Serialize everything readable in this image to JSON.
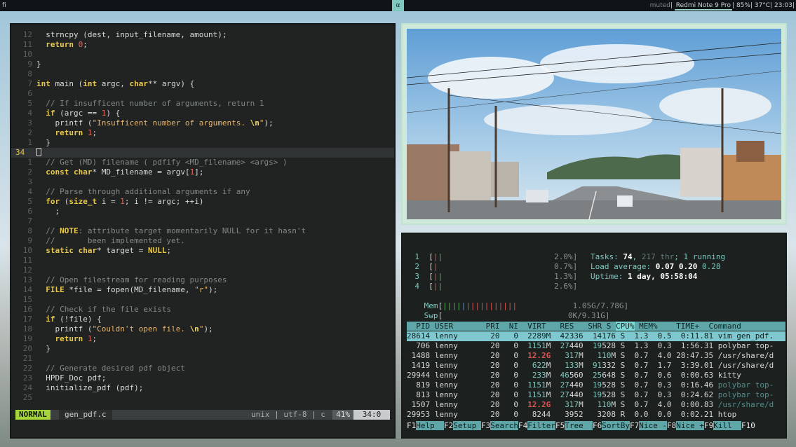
{
  "topbar": {
    "workspace": "fi",
    "layout": "α",
    "muted": "muted",
    "device": "Redmi Note 9 Pro",
    "battery": "85%",
    "temp": "37°C",
    "time": "23:03"
  },
  "editor": {
    "lines": [
      {
        "n": "12",
        "t": "  strncpy (dest, input_filename, amount);"
      },
      {
        "n": "11",
        "t": "  return 0;"
      },
      {
        "n": "10",
        "t": ""
      },
      {
        "n": "9",
        "t": "}"
      },
      {
        "n": "8",
        "t": ""
      },
      {
        "n": "7",
        "t": "int main (int argc, char** argv) {"
      },
      {
        "n": "6",
        "t": ""
      },
      {
        "n": "5",
        "t": "  // If insufficent number of arguments, return 1"
      },
      {
        "n": "4",
        "t": "  if (argc == 1) {"
      },
      {
        "n": "3",
        "t": "    printf (\"Insufficent number of arguments. \\n\");"
      },
      {
        "n": "2",
        "t": "    return 1;"
      },
      {
        "n": "1",
        "t": "  }"
      },
      {
        "n": "34",
        "t": ""
      },
      {
        "n": "1",
        "t": "  // Get (MD) filename ( pdfify <MD_filename> <args> )"
      },
      {
        "n": "2",
        "t": "  const char* MD_filename = argv[1];"
      },
      {
        "n": "3",
        "t": ""
      },
      {
        "n": "4",
        "t": "  // Parse through additional arguments if any"
      },
      {
        "n": "5",
        "t": "  for (size_t i = 1; i != argc; ++i)"
      },
      {
        "n": "6",
        "t": "    ;"
      },
      {
        "n": "7",
        "t": ""
      },
      {
        "n": "8",
        "t": "  // NOTE: attribute target momentarily NULL for it hasn't"
      },
      {
        "n": "9",
        "t": "  //       been implemented yet."
      },
      {
        "n": "10",
        "t": "  static char* target = NULL;"
      },
      {
        "n": "11",
        "t": ""
      },
      {
        "n": "12",
        "t": ""
      },
      {
        "n": "13",
        "t": "  // Open filestream for reading purposes"
      },
      {
        "n": "14",
        "t": "  FILE *file = fopen(MD_filename, \"r\");"
      },
      {
        "n": "15",
        "t": ""
      },
      {
        "n": "16",
        "t": "  // Check if the file exists"
      },
      {
        "n": "17",
        "t": "  if (!file) {"
      },
      {
        "n": "18",
        "t": "    printf (\"Couldn't open file. \\n\");"
      },
      {
        "n": "19",
        "t": "    return 1;"
      },
      {
        "n": "20",
        "t": "  }"
      },
      {
        "n": "21",
        "t": ""
      },
      {
        "n": "22",
        "t": "  // Generate desired pdf object"
      },
      {
        "n": "23",
        "t": "  HPDF_Doc pdf;"
      },
      {
        "n": "24",
        "t": "  initialize_pdf (pdf);"
      },
      {
        "n": "25",
        "t": ""
      }
    ],
    "status": {
      "mode": "NORMAL",
      "filename": "gen_pdf.c",
      "info": "unix | utf-8 | c",
      "percent": "41%",
      "position": "34:0"
    }
  },
  "htop": {
    "cpus": [
      {
        "label": "1",
        "val": "2.0%]"
      },
      {
        "label": "2",
        "val": "0.7%]"
      },
      {
        "label": "3",
        "val": "1.3%]"
      },
      {
        "label": "4",
        "val": "2.6%]"
      }
    ],
    "mem": {
      "label": "Mem",
      "val": "1.05G/7.78G]"
    },
    "swp": {
      "label": "Swp",
      "val": "0K/9.31G]"
    },
    "tasks_label": "Tasks: ",
    "tasks_count": "74",
    "thr": "217 thr",
    "running": "1 running",
    "load_label": "Load average: ",
    "load1": "0.07",
    "load5": "0.20",
    "load15": "0.28",
    "uptime_label": "Uptime: ",
    "uptime": "1 day, 05:58:04",
    "header": "  PID USER       PRI  NI  VIRT   RES   SHR S ",
    "header_sort": "CPU%",
    "header_rest": " MEM%    TIME+  Command",
    "procs": [
      {
        "pid": "28614",
        "user": "lenny",
        "pri": "20",
        "ni": "0",
        "virt": "2289M",
        "res": "42336",
        "shr": "14176",
        "s": "S",
        "cpu": "1.3",
        "mem": "0.5",
        "time": "0:11.81",
        "cmd": "vim gen_pdf."
      },
      {
        "pid": "706",
        "user": "lenny",
        "pri": "20",
        "ni": "0",
        "virt": "1151M",
        "res": "27440",
        "shr": "19528",
        "s": "S",
        "cpu": "1.3",
        "mem": "0.3",
        "time": "1:56.31",
        "cmd": "polybar top-"
      },
      {
        "pid": "1488",
        "user": "lenny",
        "pri": "20",
        "ni": "0",
        "virt": "12.2G",
        "res": "317M",
        "shr": "110M",
        "s": "S",
        "cpu": "0.7",
        "mem": "4.0",
        "time": "28:47.35",
        "cmd": "/usr/share/d"
      },
      {
        "pid": "1419",
        "user": "lenny",
        "pri": "20",
        "ni": "0",
        "virt": "622M",
        "res": "133M",
        "shr": "91332",
        "s": "S",
        "cpu": "0.7",
        "mem": "1.7",
        "time": "3:39.01",
        "cmd": "/usr/share/d"
      },
      {
        "pid": "29944",
        "user": "lenny",
        "pri": "20",
        "ni": "0",
        "virt": "233M",
        "res": "46560",
        "shr": "25648",
        "s": "S",
        "cpu": "0.7",
        "mem": "0.6",
        "time": "0:00.63",
        "cmd": "kitty"
      },
      {
        "pid": "819",
        "user": "lenny",
        "pri": "20",
        "ni": "0",
        "virt": "1151M",
        "res": "27440",
        "shr": "19528",
        "s": "S",
        "cpu": "0.7",
        "mem": "0.3",
        "time": "0:16.46",
        "cmd": "polybar top-"
      },
      {
        "pid": "813",
        "user": "lenny",
        "pri": "20",
        "ni": "0",
        "virt": "1151M",
        "res": "27440",
        "shr": "19528",
        "s": "S",
        "cpu": "0.7",
        "mem": "0.3",
        "time": "0:24.62",
        "cmd": "polybar top-"
      },
      {
        "pid": "1507",
        "user": "lenny",
        "pri": "20",
        "ni": "0",
        "virt": "12.2G",
        "res": "317M",
        "shr": "110M",
        "s": "S",
        "cpu": "0.7",
        "mem": "4.0",
        "time": "0:00.83",
        "cmd": "/usr/share/d"
      },
      {
        "pid": "29953",
        "user": "lenny",
        "pri": "20",
        "ni": "0",
        "virt": "8244",
        "res": "3952",
        "shr": "3208",
        "s": "R",
        "cpu": "0.0",
        "mem": "0.0",
        "time": "0:02.21",
        "cmd": "htop"
      }
    ],
    "fkeys": [
      {
        "k": "F1",
        "l": "Help  "
      },
      {
        "k": "F2",
        "l": "Setup "
      },
      {
        "k": "F3",
        "l": "Search"
      },
      {
        "k": "F4",
        "l": "Filter"
      },
      {
        "k": "F5",
        "l": "Tree  "
      },
      {
        "k": "F6",
        "l": "SortBy"
      },
      {
        "k": "F7",
        "l": "Nice -"
      },
      {
        "k": "F8",
        "l": "Nice +"
      },
      {
        "k": "F9",
        "l": "Kill  "
      },
      {
        "k": "F10",
        "l": ""
      }
    ]
  }
}
